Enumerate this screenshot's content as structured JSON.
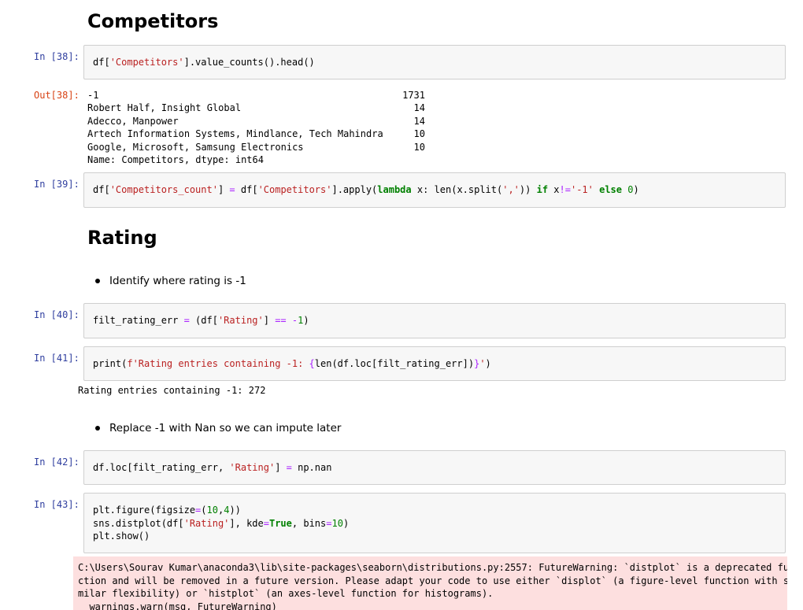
{
  "headings": {
    "competitors": "Competitors",
    "rating": "Rating"
  },
  "cells": {
    "c38": {
      "prompt": "In [38]:",
      "code": {
        "p1": "df[",
        "s1": "'Competitors'",
        "p2": "].value_counts().head()"
      }
    },
    "o38": {
      "prompt": "Out[38]:",
      "rows": [
        {
          "label": "-1",
          "count": "1731"
        },
        {
          "label": "Robert Half, Insight Global",
          "count": "14"
        },
        {
          "label": "Adecco, Manpower",
          "count": "14"
        },
        {
          "label": "Artech Information Systems, Mindlance, Tech Mahindra",
          "count": "10"
        },
        {
          "label": "Google, Microsoft, Samsung Electronics",
          "count": "10"
        }
      ],
      "footer": "Name: Competitors, dtype: int64"
    },
    "c39": {
      "prompt": "In [39]:",
      "code": {
        "p1": "df[",
        "s1": "'Competitors_count'",
        "p2": "] ",
        "o1": "=",
        "p3": " df[",
        "s2": "'Competitors'",
        "p4": "].apply(",
        "k1": "lambda",
        "p5": " x: len(x.split(",
        "s3": "','",
        "p6": ")) ",
        "k2": "if",
        "p7": " x",
        "o2": "!=",
        "s4": "'-1'",
        "p8": " ",
        "k3": "else",
        "p9": " ",
        "n1": "0",
        "p10": ")"
      }
    },
    "bullet1": "Identify where rating is -1",
    "c40": {
      "prompt": "In [40]:",
      "code": {
        "p1": "filt_rating_err ",
        "o1": "=",
        "p2": " (df[",
        "s1": "'Rating'",
        "p3": "] ",
        "o2": "==",
        "p4": " ",
        "o3": "-",
        "n1": "1",
        "p5": ")"
      }
    },
    "c41": {
      "prompt": "In [41]:",
      "code": {
        "p1": "print(",
        "s1": "f'Rating entries containing -1: ",
        "b1": "{",
        "p2": "len(df.loc[filt_rating_err])",
        "b2": "}",
        "s2": "'",
        "p3": ")"
      },
      "output": "Rating entries containing -1: 272"
    },
    "bullet2": "Replace -1 with Nan so we can impute later",
    "c42": {
      "prompt": "In [42]:",
      "code": {
        "p1": "df.loc[filt_rating_err, ",
        "s1": "'Rating'",
        "p2": "] ",
        "o1": "=",
        "p3": " np.nan"
      }
    },
    "c43": {
      "prompt": "In [43]:",
      "line1": {
        "p1": "plt.figure(figsize",
        "o1": "=",
        "p2": "(",
        "n1": "10",
        "p3": ",",
        "n2": "4",
        "p4": "))"
      },
      "line2": {
        "p1": "sns.distplot(df[",
        "s1": "'Rating'",
        "p2": "], kde",
        "o1": "=",
        "k1": "True",
        "p3": ", bins",
        "o2": "=",
        "n1": "10",
        "p4": ")"
      },
      "line3": {
        "p1": "plt.show()"
      },
      "warning": [
        "C:\\Users\\Sourav Kumar\\anaconda3\\lib\\site-packages\\seaborn\\distributions.py:2557: FutureWarning: `distplot` is a deprecated fun",
        "ction and will be removed in a future version. Please adapt your code to use either `displot` (a figure-level function with si",
        "milar flexibility) or `histplot` (an axes-level function for histograms).",
        "  warnings.warn(msg, FutureWarning)"
      ]
    }
  },
  "colors": {
    "prompt_in": "#303f9f",
    "prompt_out": "#d84315",
    "string": "#ba2121",
    "keyword": "#008000",
    "number": "#008000",
    "operator": "#aa22ff",
    "code_bg": "#f7f7f7",
    "warning_bg": "#fddfdf"
  }
}
